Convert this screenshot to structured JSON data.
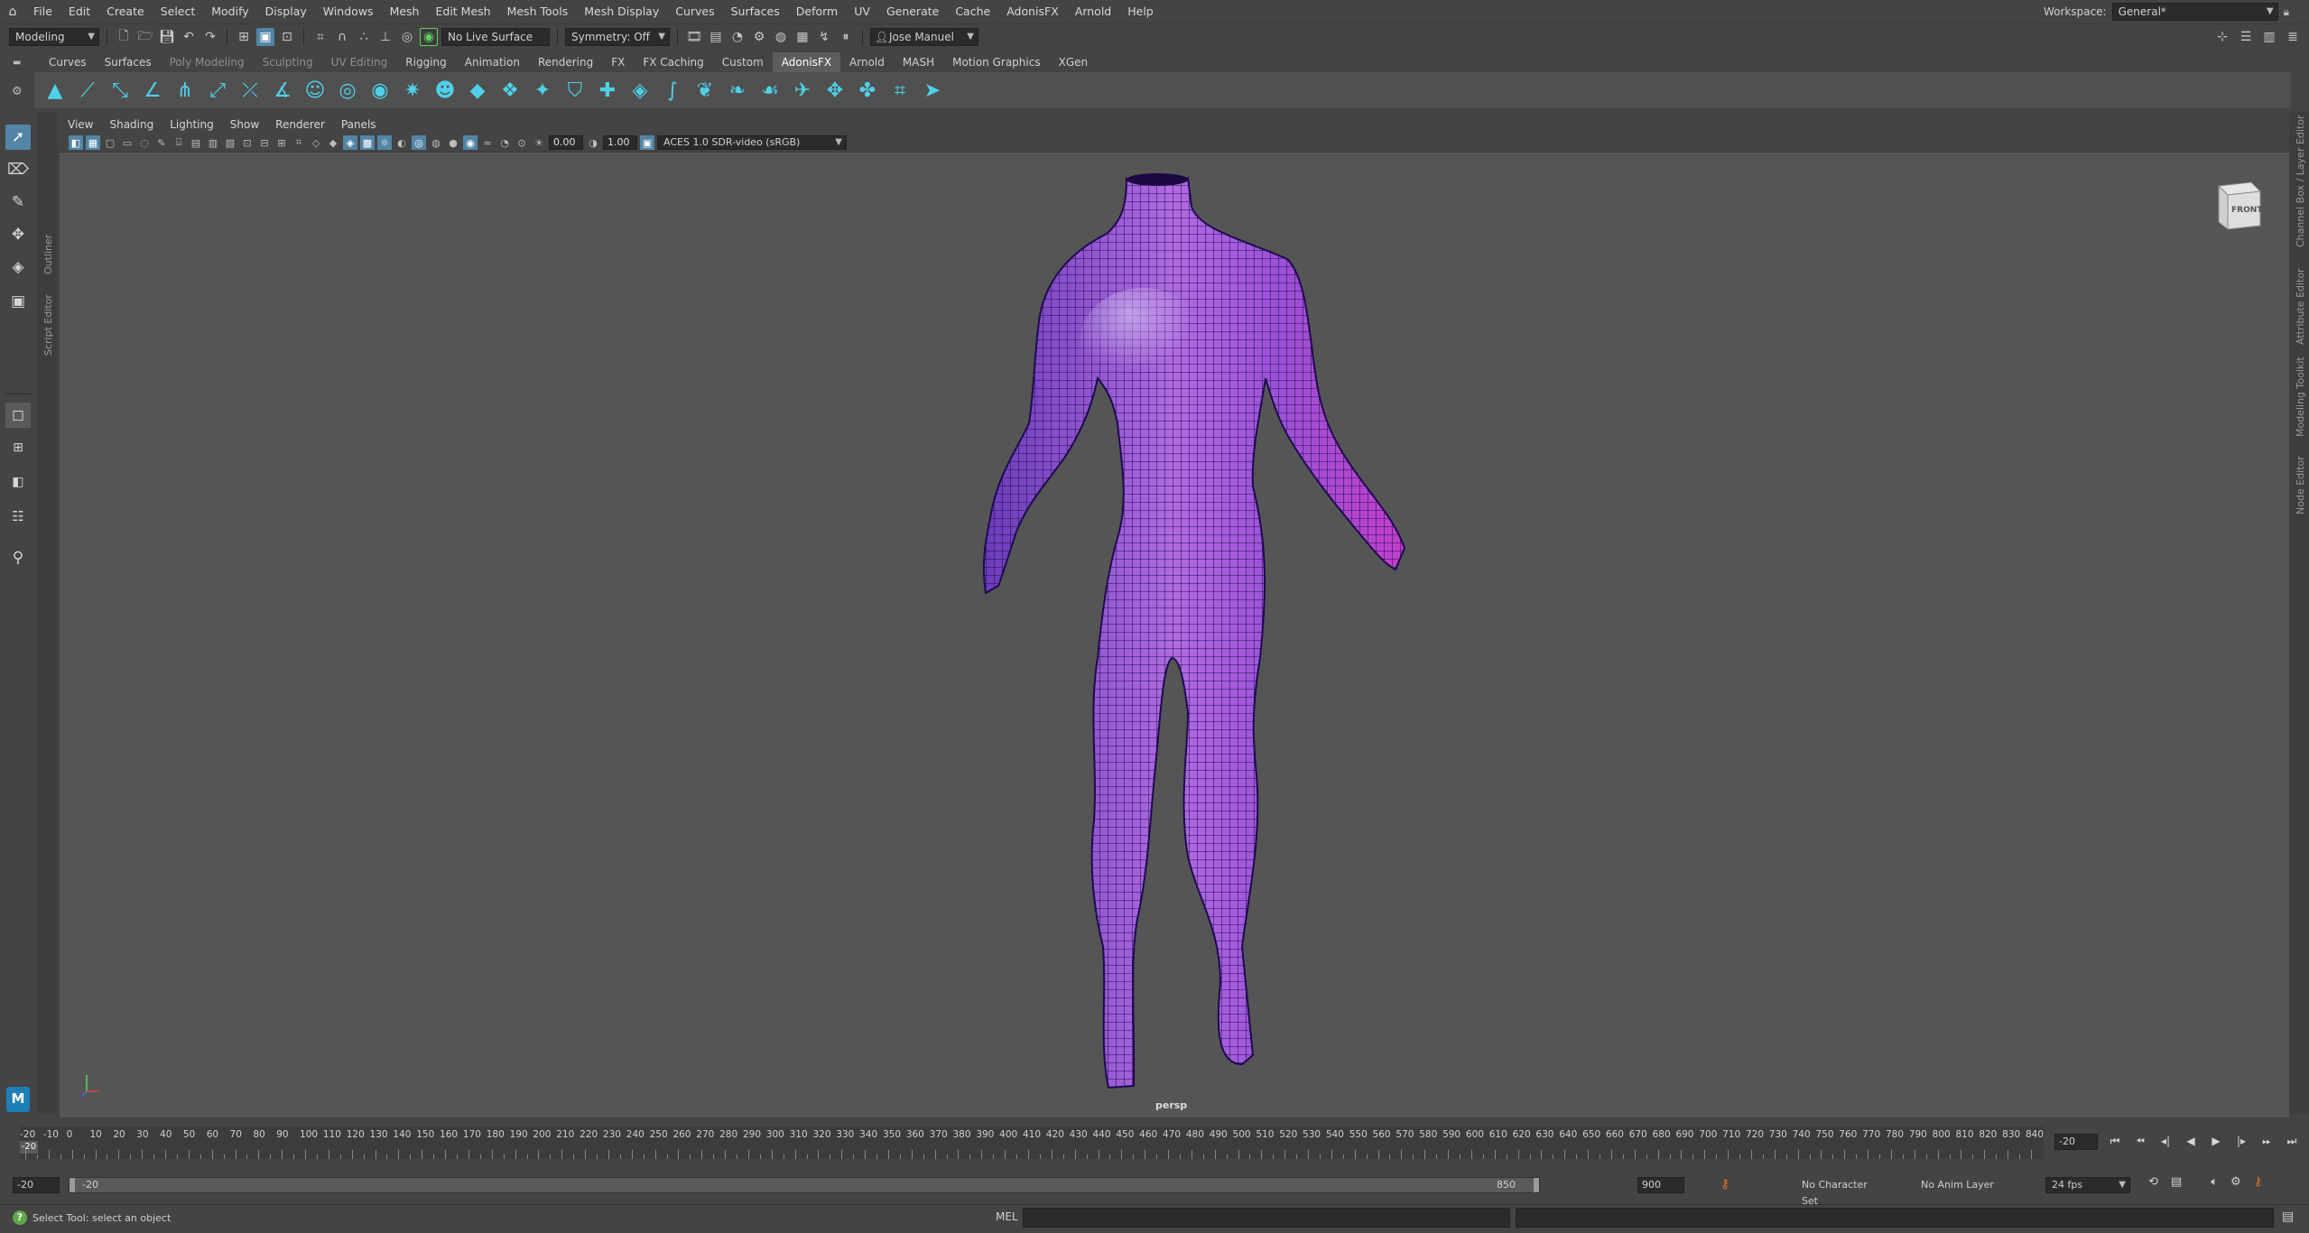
{
  "menubar": {
    "items": [
      "File",
      "Edit",
      "Create",
      "Select",
      "Modify",
      "Display",
      "Windows",
      "Mesh",
      "Edit Mesh",
      "Mesh Tools",
      "Mesh Display",
      "Curves",
      "Surfaces",
      "Deform",
      "UV",
      "Generate",
      "Cache",
      "AdonisFX",
      "Arnold",
      "Help"
    ],
    "workspace_label": "Workspace:",
    "workspace_value": "General*"
  },
  "statusline": {
    "mode": "Modeling",
    "live_surface": "No Live Surface",
    "symmetry": "Symmetry: Off",
    "user": "Jose Manuel"
  },
  "shelf": {
    "tabs": [
      {
        "label": "Curves",
        "state": "normal"
      },
      {
        "label": "Surfaces",
        "state": "normal"
      },
      {
        "label": "Poly Modeling",
        "state": "dim"
      },
      {
        "label": "Sculpting",
        "state": "dim"
      },
      {
        "label": "UV Editing",
        "state": "dim"
      },
      {
        "label": "Rigging",
        "state": "normal"
      },
      {
        "label": "Animation",
        "state": "normal"
      },
      {
        "label": "Rendering",
        "state": "normal"
      },
      {
        "label": "FX",
        "state": "normal"
      },
      {
        "label": "FX Caching",
        "state": "normal"
      },
      {
        "label": "Custom",
        "state": "normal"
      },
      {
        "label": "AdonisFX",
        "state": "selected"
      },
      {
        "label": "Arnold",
        "state": "normal"
      },
      {
        "label": "MASH",
        "state": "normal"
      },
      {
        "label": "Motion Graphics",
        "state": "normal"
      },
      {
        "label": "XGen",
        "state": "normal"
      }
    ]
  },
  "side_labels": {
    "outliner": "Outliner",
    "script_editor": "Script Editor",
    "channel_box": "Channel Box / Layer Editor",
    "attribute_editor": "Attribute Editor",
    "modeling_toolkit": "Modeling Toolkit",
    "node_editor": "Node Editor"
  },
  "viewport": {
    "menus": [
      "View",
      "Shading",
      "Lighting",
      "Show",
      "Renderer",
      "Panels"
    ],
    "exposure": "0.00",
    "gamma": "1.00",
    "color_space": "ACES 1.0 SDR-video (sRGB)",
    "camera": "persp",
    "viewcube_face": "FRONT"
  },
  "timeline": {
    "ticks": [
      "-20",
      "-10",
      "0",
      "10",
      "20",
      "30",
      "40",
      "50",
      "60",
      "70",
      "80",
      "90",
      "100",
      "110",
      "120",
      "130",
      "140",
      "150",
      "160",
      "170",
      "180",
      "190",
      "200",
      "210",
      "220",
      "230",
      "240",
      "250",
      "260",
      "270",
      "280",
      "290",
      "300",
      "310",
      "320",
      "330",
      "340",
      "350",
      "360",
      "370",
      "380",
      "390",
      "400",
      "410",
      "420",
      "430",
      "440",
      "450",
      "460",
      "470",
      "480",
      "490",
      "500",
      "510",
      "520",
      "530",
      "540",
      "550",
      "560",
      "570",
      "580",
      "590",
      "600",
      "610",
      "620",
      "630",
      "640",
      "650",
      "660",
      "670",
      "680",
      "690",
      "700",
      "710",
      "720",
      "730",
      "740",
      "750",
      "760",
      "770",
      "780",
      "790",
      "800",
      "810",
      "820",
      "830",
      "840"
    ],
    "current_frame_marker": "-20",
    "current_frame": "-20"
  },
  "range": {
    "start": "-20",
    "inner_start": "-20",
    "inner_end": "850",
    "end": "900",
    "character_set": "No Character Set",
    "anim_layer": "No Anim Layer",
    "fps": "24 fps"
  },
  "commandline": {
    "help": "Select Tool: select an object",
    "lang": "MEL"
  },
  "colors": {
    "accent": "#5285a6",
    "shelf_icon": "#4fd0e8",
    "mesh_fill": "#9a4fd6",
    "wire": "#2a1060"
  }
}
